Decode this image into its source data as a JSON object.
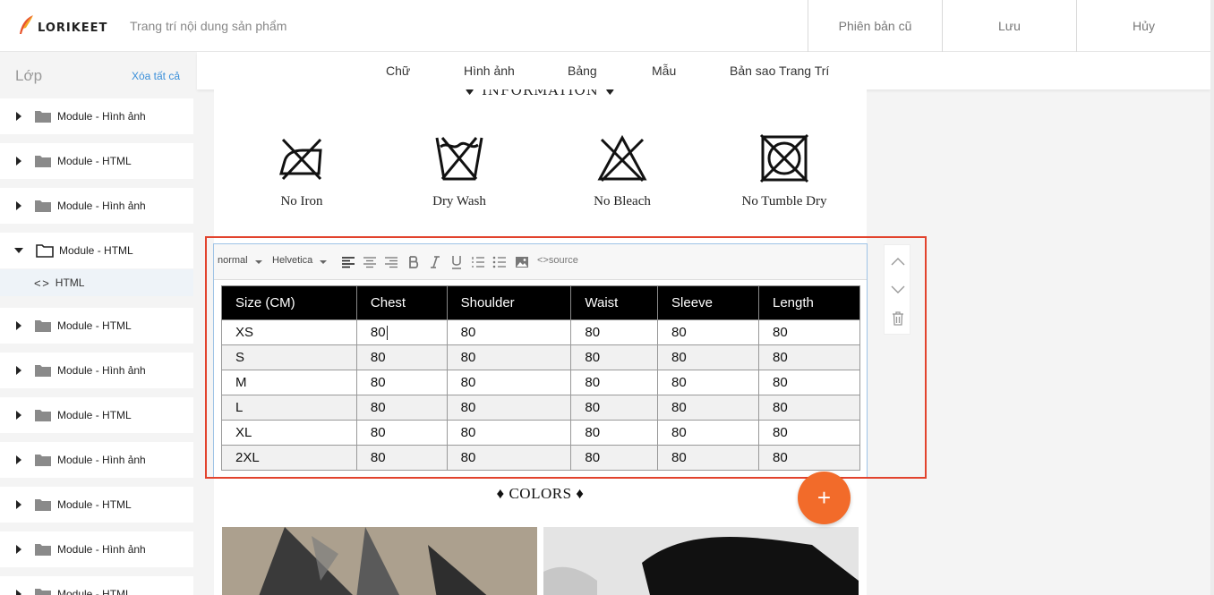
{
  "header": {
    "brand": "LORIKEET",
    "subtitle": "Trang trí nội dung sản phẩm",
    "buttons": {
      "old_version": "Phiên bản cũ",
      "save": "Lưu",
      "cancel": "Hủy"
    }
  },
  "sidebar": {
    "title": "Lớp",
    "clear_all": "Xóa tất cả",
    "items": [
      {
        "label": "Module - Hình ảnh"
      },
      {
        "label": "Module - HTML"
      },
      {
        "label": "Module - Hình ảnh"
      },
      {
        "label": "Module - HTML"
      },
      {
        "label": "Module - HTML"
      },
      {
        "label": "Module - Hình ảnh"
      },
      {
        "label": "Module - HTML"
      },
      {
        "label": "Module - Hình ảnh"
      },
      {
        "label": "Module - HTML"
      },
      {
        "label": "Module - Hình ảnh"
      },
      {
        "label": "Module - HTML"
      }
    ],
    "sub_item": {
      "code": "< >",
      "label": "HTML"
    }
  },
  "tabs": [
    "Chữ",
    "Hình ảnh",
    "Bảng",
    "Mẫu",
    "Bản sao Trang Trí"
  ],
  "canvas": {
    "info_heading": "♦ INFORMATION ♦",
    "care_labels": [
      "No Iron",
      "Dry Wash",
      "No Bleach",
      "No Tumble Dry"
    ],
    "colors_heading": "♦ COLORS ♦"
  },
  "editor": {
    "format": "normal",
    "font": "Helvetica",
    "source_label": "source",
    "table": {
      "headers": [
        "Size (CM)",
        "Chest",
        "Shoulder",
        "Waist",
        "Sleeve",
        "Length"
      ],
      "rows": [
        [
          "XS",
          "80",
          "80",
          "80",
          "80",
          "80"
        ],
        [
          "S",
          "80",
          "80",
          "80",
          "80",
          "80"
        ],
        [
          "M",
          "80",
          "80",
          "80",
          "80",
          "80"
        ],
        [
          "L",
          "80",
          "80",
          "80",
          "80",
          "80"
        ],
        [
          "XL",
          "80",
          "80",
          "80",
          "80",
          "80"
        ],
        [
          "2XL",
          "80",
          "80",
          "80",
          "80",
          "80"
        ]
      ]
    }
  },
  "fab": {
    "label": "+"
  },
  "colors": {
    "accent": "#f26b2a",
    "selection": "#e2432d",
    "link": "#3a8fd9"
  }
}
